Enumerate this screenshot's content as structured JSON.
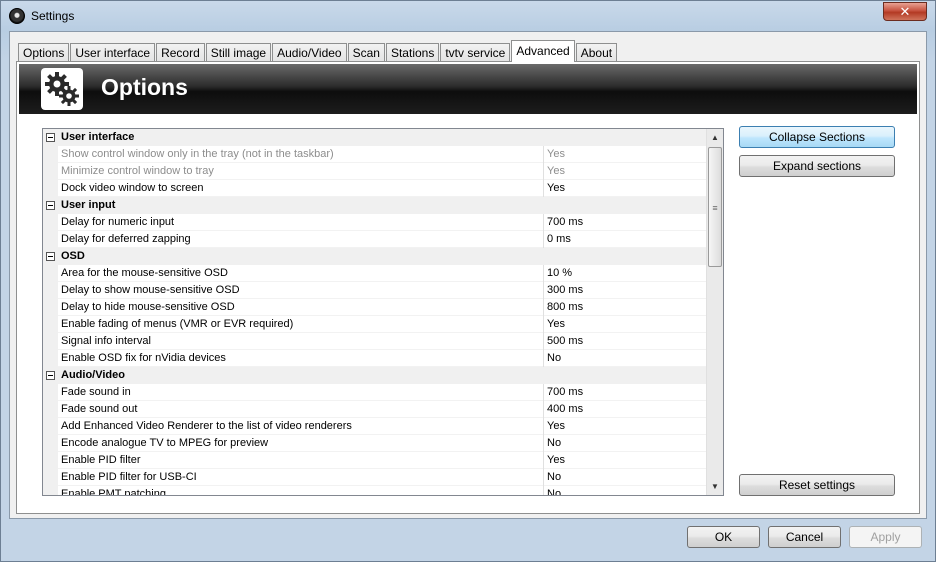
{
  "window": {
    "title": "Settings",
    "close_glyph": "✕"
  },
  "tabs": [
    {
      "label": "Options",
      "active": false
    },
    {
      "label": "User interface",
      "active": false
    },
    {
      "label": "Record",
      "active": false
    },
    {
      "label": "Still image",
      "active": false
    },
    {
      "label": "Audio/Video",
      "active": false
    },
    {
      "label": "Scan",
      "active": false
    },
    {
      "label": "Stations",
      "active": false
    },
    {
      "label": "tvtv service",
      "active": false
    },
    {
      "label": "Advanced",
      "active": true
    },
    {
      "label": "About",
      "active": false
    }
  ],
  "banner": {
    "title": "Options",
    "icon": "gears-icon"
  },
  "settings": [
    {
      "type": "section",
      "name": "User interface"
    },
    {
      "type": "item",
      "name": "Show control window only in the tray (not in the taskbar)",
      "value": "Yes",
      "disabled": true
    },
    {
      "type": "item",
      "name": "Minimize control window to tray",
      "value": "Yes",
      "disabled": true
    },
    {
      "type": "item",
      "name": "Dock video window to screen",
      "value": "Yes",
      "disabled": false
    },
    {
      "type": "section",
      "name": "User input"
    },
    {
      "type": "item",
      "name": "Delay for numeric input",
      "value": "700 ms",
      "disabled": false
    },
    {
      "type": "item",
      "name": "Delay for deferred zapping",
      "value": "0 ms",
      "disabled": false
    },
    {
      "type": "section",
      "name": "OSD"
    },
    {
      "type": "item",
      "name": "Area for the mouse-sensitive OSD",
      "value": "10 %",
      "disabled": false
    },
    {
      "type": "item",
      "name": "Delay to show mouse-sensitive OSD",
      "value": "300 ms",
      "disabled": false
    },
    {
      "type": "item",
      "name": "Delay to hide mouse-sensitive OSD",
      "value": "800 ms",
      "disabled": false
    },
    {
      "type": "item",
      "name": "Enable fading of menus (VMR or EVR required)",
      "value": "Yes",
      "disabled": false
    },
    {
      "type": "item",
      "name": "Signal info interval",
      "value": "500 ms",
      "disabled": false
    },
    {
      "type": "item",
      "name": "Enable OSD fix for nVidia devices",
      "value": "No",
      "disabled": false
    },
    {
      "type": "section",
      "name": "Audio/Video"
    },
    {
      "type": "item",
      "name": "Fade sound in",
      "value": "700 ms",
      "disabled": false
    },
    {
      "type": "item",
      "name": "Fade sound out",
      "value": "400 ms",
      "disabled": false
    },
    {
      "type": "item",
      "name": "Add Enhanced Video Renderer to the list of video renderers",
      "value": "Yes",
      "disabled": false
    },
    {
      "type": "item",
      "name": "Encode analogue TV to MPEG for preview",
      "value": "No",
      "disabled": false
    },
    {
      "type": "item",
      "name": "Enable PID filter",
      "value": "Yes",
      "disabled": false
    },
    {
      "type": "item",
      "name": "Enable PID filter for USB-CI",
      "value": "No",
      "disabled": false
    },
    {
      "type": "item",
      "name": "Enable PMT patching",
      "value": "No",
      "disabled": false
    }
  ],
  "side_buttons": {
    "collapse": "Collapse Sections",
    "expand": "Expand sections",
    "reset": "Reset settings"
  },
  "footer": {
    "ok": "OK",
    "cancel": "Cancel",
    "apply": "Apply"
  }
}
